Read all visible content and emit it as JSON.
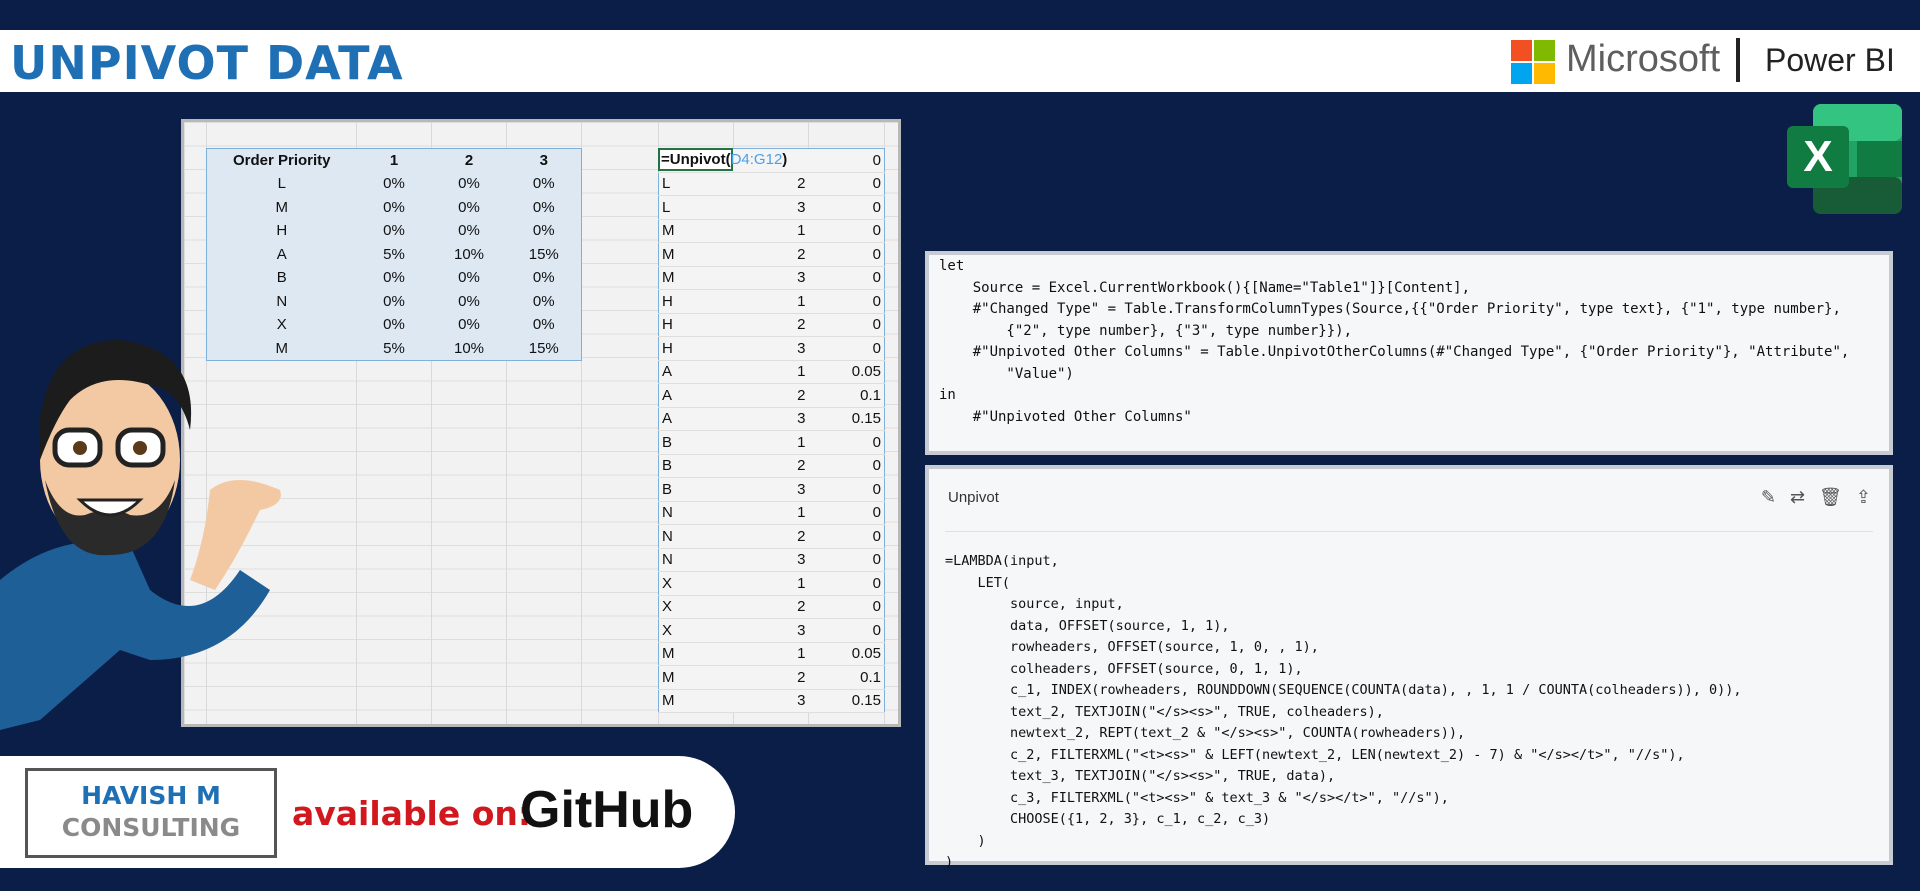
{
  "header": {
    "title": "UNPIVOT DATA",
    "brand_ms": "Microsoft",
    "brand_pbi": "Power BI",
    "ms_colors": [
      "#f25022",
      "#7fba00",
      "#00a4ef",
      "#ffb900"
    ]
  },
  "sheet": {
    "source_headers": [
      "Order Priority",
      "1",
      "2",
      "3"
    ],
    "source_rows": [
      [
        "L",
        "0%",
        "0%",
        "0%"
      ],
      [
        "M",
        "0%",
        "0%",
        "0%"
      ],
      [
        "H",
        "0%",
        "0%",
        "0%"
      ],
      [
        "A",
        "5%",
        "10%",
        "15%"
      ],
      [
        "B",
        "0%",
        "0%",
        "0%"
      ],
      [
        "N",
        "0%",
        "0%",
        "0%"
      ],
      [
        "X",
        "0%",
        "0%",
        "0%"
      ],
      [
        "M",
        "5%",
        "10%",
        "15%"
      ]
    ],
    "formula": "=Unpivot(",
    "formula_ref": "D4:G12",
    "formula_close": ")",
    "output_first_value": "0",
    "output_rows": [
      [
        "L",
        "2",
        "0"
      ],
      [
        "L",
        "3",
        "0"
      ],
      [
        "M",
        "1",
        "0"
      ],
      [
        "M",
        "2",
        "0"
      ],
      [
        "M",
        "3",
        "0"
      ],
      [
        "H",
        "1",
        "0"
      ],
      [
        "H",
        "2",
        "0"
      ],
      [
        "H",
        "3",
        "0"
      ],
      [
        "A",
        "1",
        "0.05"
      ],
      [
        "A",
        "2",
        "0.1"
      ],
      [
        "A",
        "3",
        "0.15"
      ],
      [
        "B",
        "1",
        "0"
      ],
      [
        "B",
        "2",
        "0"
      ],
      [
        "B",
        "3",
        "0"
      ],
      [
        "N",
        "1",
        "0"
      ],
      [
        "N",
        "2",
        "0"
      ],
      [
        "N",
        "3",
        "0"
      ],
      [
        "X",
        "1",
        "0"
      ],
      [
        "X",
        "2",
        "0"
      ],
      [
        "X",
        "3",
        "0"
      ],
      [
        "M",
        "1",
        "0.05"
      ],
      [
        "M",
        "2",
        "0.1"
      ],
      [
        "M",
        "3",
        "0.15"
      ]
    ]
  },
  "powerquery": {
    "code": "let\n    Source = Excel.CurrentWorkbook(){[Name=\"Table1\"]}[Content],\n    #\"Changed Type\" = Table.TransformColumnTypes(Source,{{\"Order Priority\", type text}, {\"1\", type number},\n        {\"2\", type number}, {\"3\", type number}}),\n    #\"Unpivoted Other Columns\" = Table.UnpivotOtherColumns(#\"Changed Type\", {\"Order Priority\"}, \"Attribute\",\n        \"Value\")\nin\n    #\"Unpivoted Other Columns\""
  },
  "lambda": {
    "name": "Unpivot",
    "icons": [
      "edit-icon",
      "rename-icon",
      "delete-icon",
      "share-icon"
    ],
    "code": "=LAMBDA(input,\n    LET(\n        source, input,\n        data, OFFSET(source, 1, 1),\n        rowheaders, OFFSET(source, 1, 0, , 1),\n        colheaders, OFFSET(source, 0, 1, 1),\n        c_1, INDEX(rowheaders, ROUNDDOWN(SEQUENCE(COUNTA(data), , 1, 1 / COUNTA(colheaders)), 0)),\n        text_2, TEXTJOIN(\"</s><s>\", TRUE, colheaders),\n        newtext_2, REPT(text_2 & \"</s><s>\", COUNTA(rowheaders)),\n        c_2, FILTERXML(\"<t><s>\" & LEFT(newtext_2, LEN(newtext_2) - 7) & \"</s></t>\", \"//s\"),\n        text_3, TEXTJOIN(\"</s><s>\", TRUE, data),\n        c_3, FILTERXML(\"<t><s>\" & text_3 & \"</s></t>\", \"//s\"),\n        CHOOSE({1, 2, 3}, c_1, c_2, c_3)\n    )\n)"
  },
  "badge": {
    "line1": "HAVISH M",
    "line2": "CONSULTING",
    "available": "available on:",
    "github": "GitHub"
  },
  "excel_logo_letter": "X"
}
